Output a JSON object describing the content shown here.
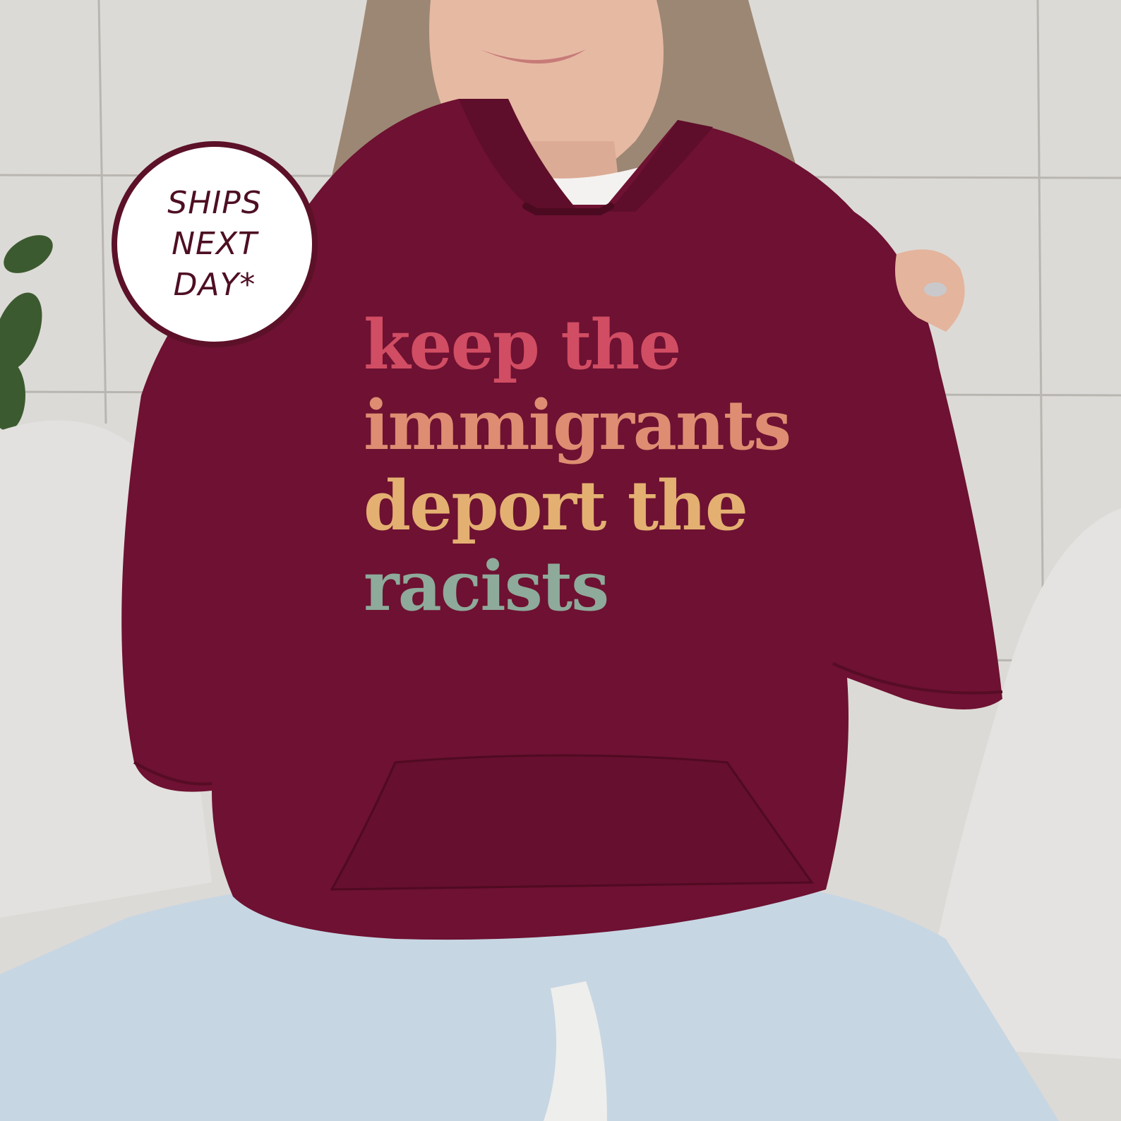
{
  "badge": {
    "line1": "SHIPS",
    "line2": "NEXT",
    "line3": "DAY*"
  },
  "slogan": {
    "line1": "keep the",
    "line2": "immigrants",
    "line3": "deport the",
    "line4": "racists"
  },
  "colors": {
    "hoodie": "#6e1132",
    "badge_ring": "#5c1129",
    "line1": "#d14d63",
    "line2": "#de8d72",
    "line3": "#e3b071",
    "line4": "#8eaa9a",
    "wall": "#dcdad6",
    "jeans": "#c7d6e3"
  }
}
